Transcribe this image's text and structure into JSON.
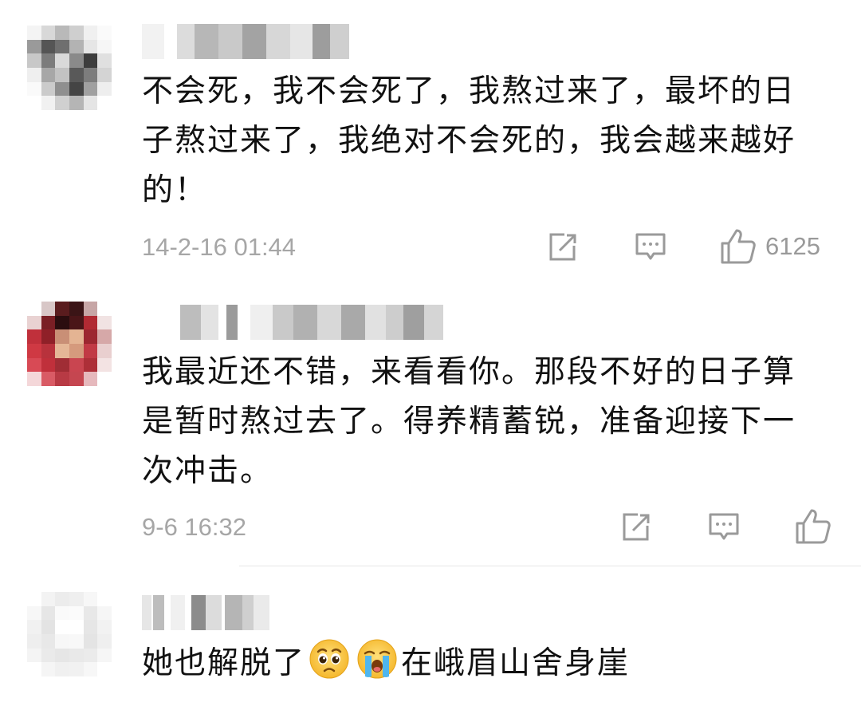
{
  "comments": [
    {
      "text": "不会死，我不会死了，我熬过来了，最坏的日子熬过来了，我绝对不会死的，我会越来越好的！",
      "time": "14-2-16 01:44",
      "likes": "6125"
    },
    {
      "text": "我最近还不错，来看看你。那段不好的日子算是暂时熬过去了。得养精蓄锐，准备迎接下一次冲击。",
      "time": "9-6 16:32",
      "likes": ""
    },
    {
      "text_before": "她也解脱了",
      "emoji_1": "pleading-face-emoji",
      "emoji_2": "loudly-crying-face-emoji",
      "text_after": "在峨眉山舍身崖"
    }
  ],
  "icons": {
    "share": "share-icon",
    "reply": "comment-icon",
    "like": "thumbs-up-icon"
  },
  "colors": {
    "text": "#111111",
    "meta": "#a6a6a6",
    "icon": "#9a9a9a"
  }
}
